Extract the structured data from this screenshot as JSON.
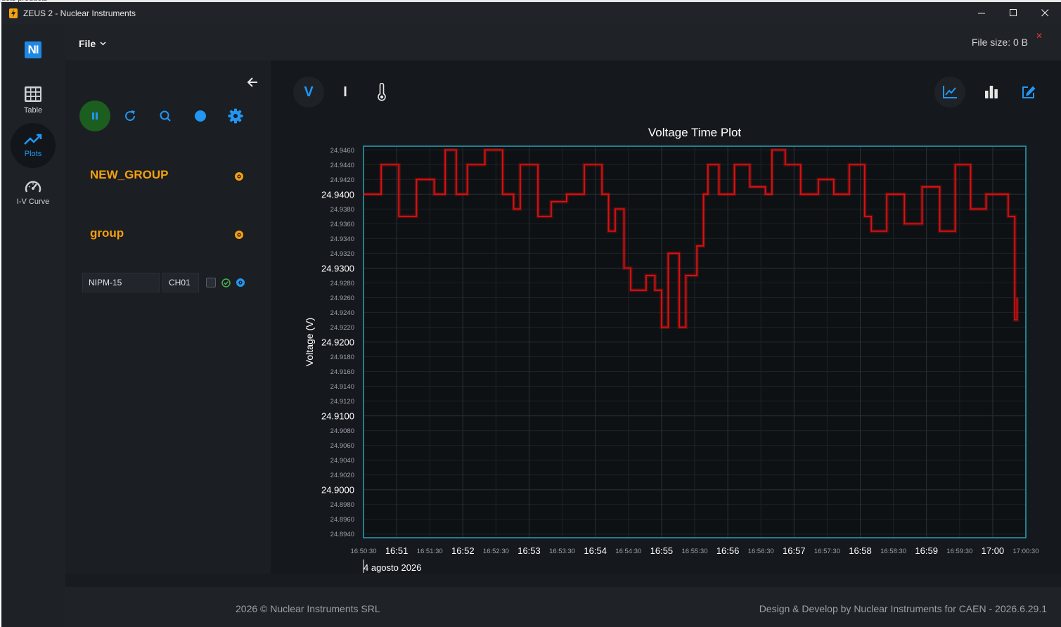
{
  "window": {
    "title": "ZEUS 2 - Nuclear Instruments"
  },
  "nav": {
    "logo": "NI",
    "items": [
      {
        "label": "Table",
        "icon": "table-grid-icon"
      },
      {
        "label": "Plots",
        "icon": "trending-up-icon",
        "active": true
      },
      {
        "label": "I-V Curve",
        "icon": "speedometer-icon"
      }
    ]
  },
  "topbar": {
    "file_label": "File",
    "file_size": "File size: 0 B"
  },
  "sidepanel": {
    "groups": [
      {
        "name": "NEW_GROUP"
      },
      {
        "name": "group"
      }
    ],
    "device": {
      "name": "NIPM-15",
      "channel": "CH01"
    }
  },
  "plot_tabs": [
    "V",
    "I"
  ],
  "colors": {
    "accent": "#2196f3",
    "group": "#f5a00f",
    "series": "#e01010",
    "pause": "#1b5e20"
  },
  "footer": {
    "left": "2026 © Nuclear Instruments SRL",
    "right": "Design & Develop by Nuclear Instruments for CAEN - 2026.6.29.1"
  },
  "chart_data": {
    "type": "line",
    "title": "Voltage Time Plot",
    "ylabel": "Voltage (V)",
    "date_label": "4 agosto 2026",
    "ylim": [
      24.8935,
      24.9465
    ],
    "y_major_ticks": [
      "24.9400",
      "24.9300",
      "24.9200",
      "24.9100",
      "24.9000"
    ],
    "y_minor_ticks": [
      "24.9460",
      "24.9440",
      "24.9420",
      "24.9380",
      "24.9360",
      "24.9340",
      "24.9320",
      "24.9280",
      "24.9260",
      "24.9240",
      "24.9220",
      "24.9180",
      "24.9160",
      "24.9140",
      "24.9120",
      "24.9080",
      "24.9060",
      "24.9040",
      "24.9020",
      "24.8980",
      "24.8960",
      "24.8940"
    ],
    "x_range": [
      "16:50:30",
      "17:00:30"
    ],
    "x_ticks": [
      "16:50:30",
      "16:51",
      "16:51:30",
      "16:52",
      "16:52:30",
      "16:53",
      "16:53:30",
      "16:54",
      "16:54:30",
      "16:55",
      "16:55:30",
      "16:56",
      "16:56:30",
      "16:57",
      "16:57:30",
      "16:58",
      "16:58:30",
      "16:59",
      "16:59:30",
      "17:00",
      "17:00:30"
    ],
    "grid": true,
    "series": [
      {
        "x": [
          "16:50:30",
          "16:50:46",
          "16:51:02",
          "16:51:18",
          "16:51:34",
          "16:51:44",
          "16:51:54",
          "16:52:04",
          "16:52:20",
          "16:52:36",
          "16:52:46",
          "16:52:52",
          "16:53:08",
          "16:53:20",
          "16:53:34",
          "16:53:50",
          "16:54:06",
          "16:54:12",
          "16:54:18",
          "16:54:26",
          "16:54:32",
          "16:54:46",
          "16:54:54",
          "16:55:00",
          "16:55:06",
          "16:55:16",
          "16:55:22",
          "16:55:32",
          "16:55:38",
          "16:55:42",
          "16:55:52",
          "16:56:06",
          "16:56:20",
          "16:56:34",
          "16:56:40",
          "16:56:52",
          "16:57:06",
          "16:57:22",
          "16:57:36",
          "16:57:50",
          "16:58:04",
          "16:58:10",
          "16:58:24",
          "16:58:40",
          "16:58:56",
          "16:59:12",
          "16:59:26",
          "16:59:40",
          "16:59:54",
          "17:00:08",
          "17:00:14",
          "17:00:20",
          "17:00:22"
        ],
        "values": [
          24.94,
          24.944,
          24.937,
          24.942,
          24.94,
          24.946,
          24.94,
          24.944,
          24.946,
          24.94,
          24.938,
          24.944,
          24.937,
          24.939,
          24.94,
          24.944,
          24.94,
          24.935,
          24.938,
          24.93,
          24.927,
          24.929,
          24.927,
          24.922,
          24.932,
          24.922,
          24.929,
          24.933,
          24.94,
          24.944,
          24.94,
          24.944,
          24.941,
          24.94,
          24.946,
          24.944,
          24.94,
          24.942,
          24.94,
          24.944,
          24.937,
          24.935,
          24.94,
          24.936,
          24.941,
          24.935,
          24.944,
          24.938,
          24.94,
          24.94,
          24.937,
          24.923,
          24.926
        ]
      }
    ]
  }
}
